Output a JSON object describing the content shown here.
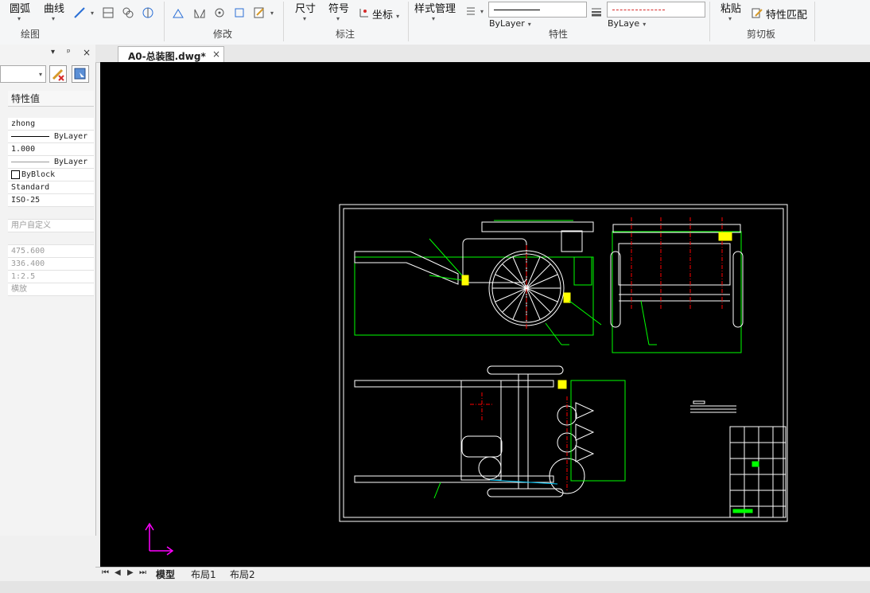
{
  "ribbon": {
    "draw_group": {
      "arc": "圆弧",
      "curve": "曲线",
      "label": "绘图"
    },
    "modify_group": {
      "label": "修改"
    },
    "annotate_group": {
      "dimension": "尺寸",
      "symbol": "符号",
      "coord": "坐标",
      "label": "标注"
    },
    "props_group": {
      "style_mgr": "样式管理",
      "linetype": "ByLayer",
      "layer_line": "ByLaye",
      "label": "特性"
    },
    "clipboard_group": {
      "paste": "粘贴",
      "match_props": "特性匹配",
      "label": "剪切板"
    }
  },
  "doc_tab": {
    "title": "A0-总装图.dwg*"
  },
  "panel": {
    "header": "特性值",
    "rows": [
      "zhong",
      "ByLayer",
      "1.000",
      "ByLayer",
      "ByBlock",
      "Standard",
      "ISO-25",
      "",
      "用户自定义",
      "",
      "475.600",
      "336.400",
      "1:2.5",
      "横放"
    ]
  },
  "layout_tabs": [
    "模型",
    "布局1",
    "布局2"
  ],
  "colors": {
    "canvas": "#000000",
    "drawing_green": "#00ff00",
    "drawing_white": "#ffffff",
    "accent_red": "#ff0000",
    "axis": "#ff00ff"
  }
}
